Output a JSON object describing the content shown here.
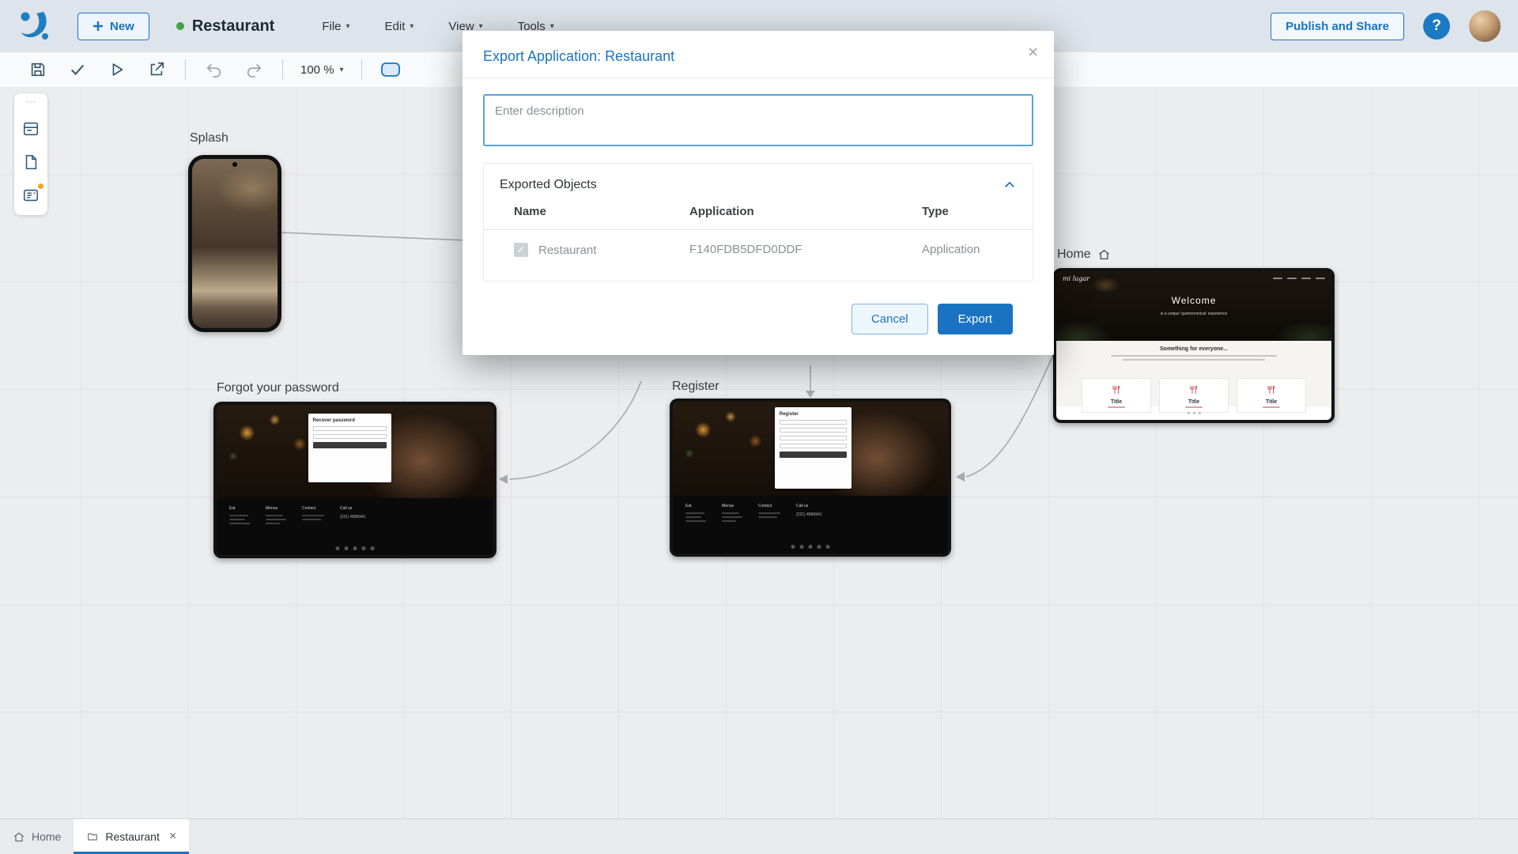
{
  "icons": {
    "close": "×",
    "check": "✓",
    "caret_down": "▾",
    "dots_handle": "⋯",
    "help": "?"
  },
  "header": {
    "new_label": "New",
    "app_title": "Restaurant",
    "menus": {
      "file": "File",
      "edit": "Edit",
      "view": "View",
      "tools": "Tools"
    },
    "publish_label": "Publish and Share"
  },
  "toolbar": {
    "zoom_value": "100 %"
  },
  "canvas": {
    "splash_label": "Splash",
    "forgot_label": "Forgot your password",
    "register_label": "Register",
    "home_label": "Home",
    "screens": {
      "recover_title": "Recover password",
      "register_title": "Register",
      "welcome_title": "Welcome",
      "welcome_subtitle": "is a unique 'gastronomical' experience",
      "section_title": "Something for everyone...",
      "card_title": "Title",
      "brand": "mi lugar",
      "footer_cols": [
        "Eat",
        "Menus",
        "Contact",
        "Call us"
      ],
      "phone": "(221) 4896941"
    }
  },
  "modal": {
    "title": "Export Application: Restaurant",
    "description_placeholder": "Enter description",
    "section_title": "Exported Objects",
    "columns": {
      "name": "Name",
      "application": "Application",
      "type": "Type"
    },
    "row": {
      "name": "Restaurant",
      "application": "F140FDB5DFD0DDF",
      "type": "Application"
    },
    "cancel_label": "Cancel",
    "export_label": "Export"
  },
  "footer": {
    "home_tab": "Home",
    "restaurant_tab": "Restaurant"
  }
}
